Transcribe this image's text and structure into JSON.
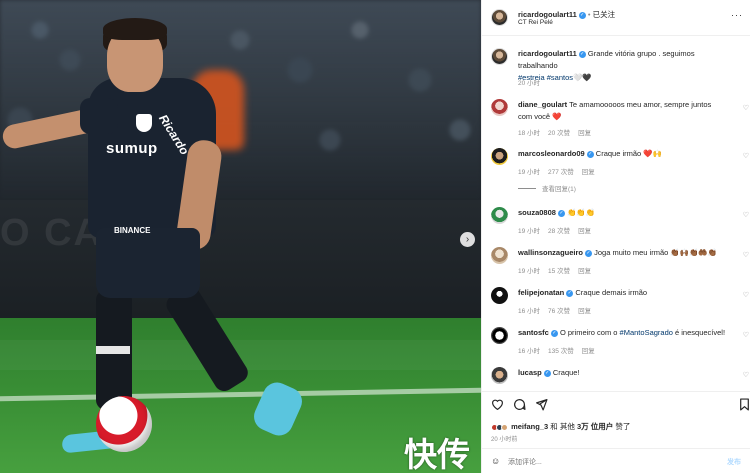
{
  "post": {
    "author": "ricardogoulart11",
    "follow_status": "已关注",
    "location": "CT Rei Pelé",
    "more_label": "···"
  },
  "photo": {
    "watermark": "快传",
    "next_label": "›",
    "sponsor_main": "sumup",
    "sponsor_side": "Ricardo",
    "sponsor_shorts": "BINANCE",
    "boards_text": "O CANSO"
  },
  "caption": {
    "user": "ricardogoulart11",
    "text": "Grande vitória grupo . seguimos trabalhando",
    "tags": "#estreia #santos",
    "emoji": "🤍🖤",
    "time": "20 小时"
  },
  "comments": [
    {
      "user": "diane_goulart",
      "verified": false,
      "text": "Te amamooooos meu amor, sempre juntos com você",
      "emoji": "❤️",
      "time": "18 小时",
      "likes": "20 次赞",
      "reply": "回复",
      "avatar": "av-diane"
    },
    {
      "user": "marcosleonardo09",
      "verified": true,
      "text": "Craque irmão",
      "emoji": "❤️🙌",
      "time": "19 小时",
      "likes": "277 次赞",
      "reply": "回复",
      "avatar": "av-marcos",
      "view_replies": "查看回复(1)"
    },
    {
      "user": "souza0808",
      "verified": true,
      "text": "",
      "emoji": "👏👏👏",
      "time": "19 小时",
      "likes": "28 次赞",
      "reply": "回复",
      "avatar": "av-souza"
    },
    {
      "user": "wallinsonzagueiro",
      "verified": true,
      "text": "Joga muito meu irmão",
      "emoji": "👏🏾🙌🏾👏🏾🤲🏾👏🏾",
      "time": "19 小时",
      "likes": "15 次赞",
      "reply": "回复",
      "avatar": "av-wallinson"
    },
    {
      "user": "felipejonatan",
      "verified": true,
      "text": "Craque demais irmão",
      "emoji": "",
      "time": "16 小时",
      "likes": "76 次赞",
      "reply": "回复",
      "avatar": "av-felipe"
    },
    {
      "user": "santosfc",
      "verified": true,
      "text": "O primeiro com o ",
      "tag": "#MantoSagrado",
      "text_after": " é inesquecível!",
      "time": "16 小时",
      "likes": "135 次赞",
      "reply": "回复",
      "avatar": "av-santos"
    },
    {
      "user": "lucasp",
      "verified": true,
      "text": "Craque!",
      "emoji": "",
      "avatar": "av-lucasp"
    }
  ],
  "likes_line": {
    "user": "meifang_3",
    "middle": " 和 其他 ",
    "count": "3万 位用户",
    "tail": " 赞了"
  },
  "time_ago": "20 小时前",
  "add_comment": {
    "emoji_icon": "☺",
    "placeholder": "添加评论...",
    "post_label": "发布"
  },
  "colors": {
    "verified": "#3897f0",
    "link": "#00376b",
    "muted": "#8e8e8e",
    "heart_red": "#ed4956",
    "boot": "#5ac5de"
  },
  "icons": {
    "like": "heart-icon",
    "comment": "comment-icon",
    "share": "paper-plane-icon",
    "save": "bookmark-icon"
  }
}
